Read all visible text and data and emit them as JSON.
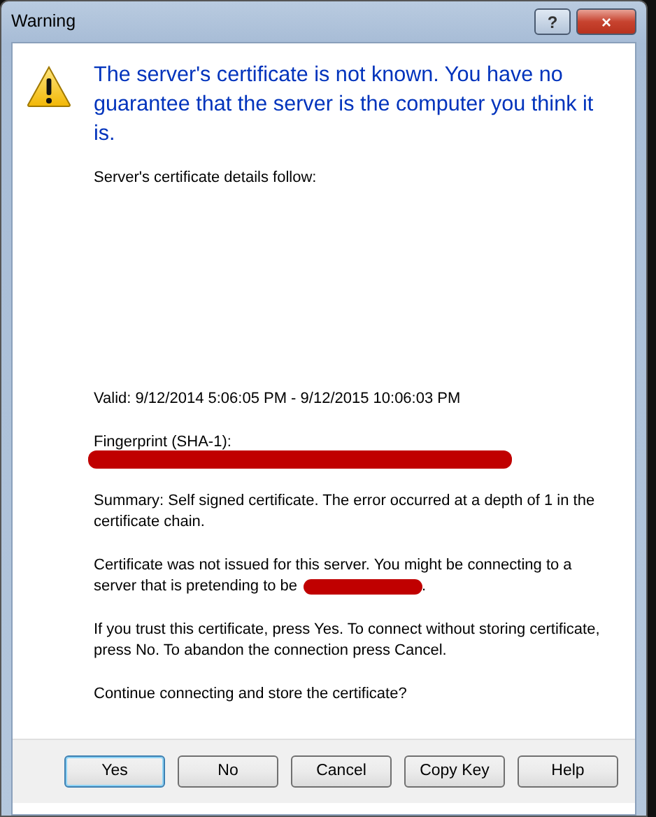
{
  "window": {
    "title": "Warning",
    "controls": [
      "?",
      "×"
    ]
  },
  "heading": "The server's certificate is not known. You have no guarantee that the server is the computer you think it is.",
  "details_intro": "Server's certificate details follow:",
  "valid": "Valid: 9/12/2014 5:06:05 PM - 9/12/2015 10:06:03 PM",
  "fingerprint_label": "Fingerprint (SHA-1):",
  "summary": "Summary: Self signed certificate. The error occurred at a depth of 1 in the certificate chain.",
  "mismatch": {
    "line_1": "Certificate was not issued for this server. You might be connecting to a",
    "line_2": "server that is pretending to be",
    "end": "."
  },
  "instructions": "If you trust this certificate, press Yes. To connect without storing certificate, press No. To abandon the connection press Cancel.",
  "question": "Continue connecting and store the certificate?",
  "buttons": [
    {
      "label": "Yes",
      "default": true
    },
    {
      "label": "No",
      "default": false
    },
    {
      "label": "Cancel",
      "default": false
    },
    {
      "label": "Copy Key",
      "default": false
    },
    {
      "label": "Help",
      "default": false
    }
  ]
}
